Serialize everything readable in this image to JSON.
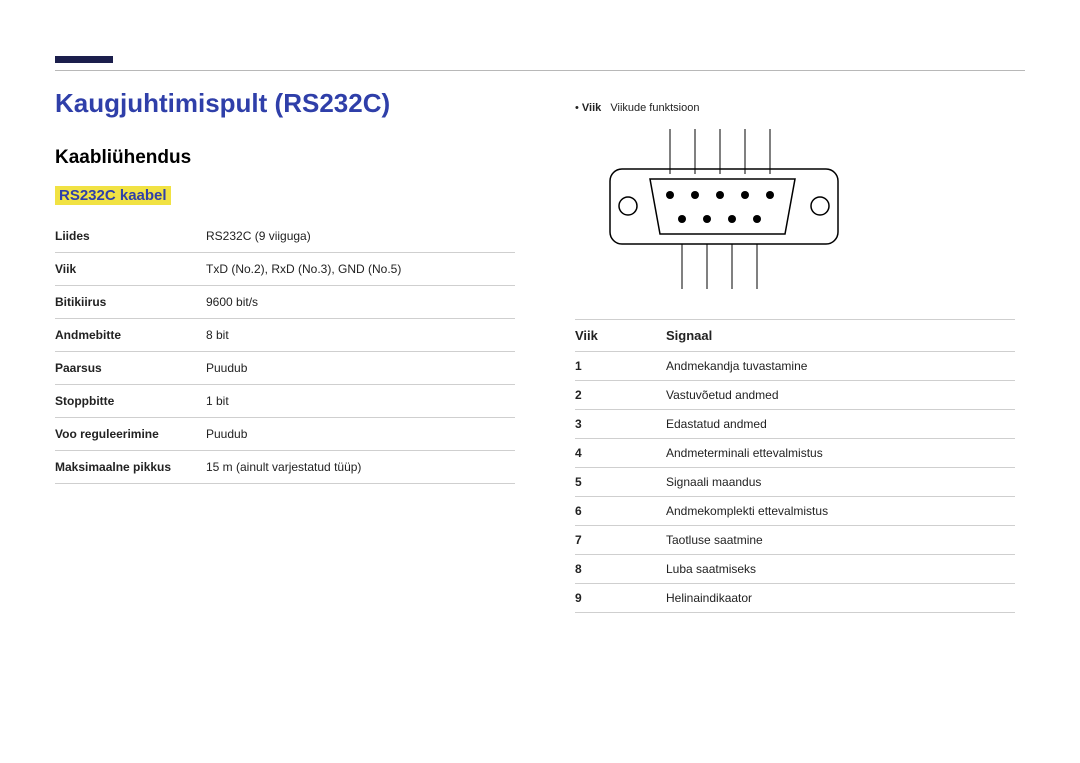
{
  "headings": {
    "title": "Kaugjuhtimispult (RS232C)",
    "section": "Kaabliühendus",
    "subsection": "RS232C kaabel"
  },
  "spec": {
    "rows": [
      {
        "label": "Liides",
        "value": "RS232C (9 viiguga)"
      },
      {
        "label": "Viik",
        "value": "TxD (No.2), RxD (No.3), GND (No.5)"
      },
      {
        "label": "Bitikiirus",
        "value": "9600 bit/s"
      },
      {
        "label": "Andmebitte",
        "value": "8 bit"
      },
      {
        "label": "Paarsus",
        "value": "Puudub"
      },
      {
        "label": "Stoppbitte",
        "value": "1 bit"
      },
      {
        "label": "Voo reguleerimine",
        "value": "Puudub"
      },
      {
        "label": "Maksimaalne pikkus",
        "value": "15 m (ainult varjestatud tüüp)"
      }
    ]
  },
  "right": {
    "legend_label": "Viik",
    "legend_text": "Viikude funktsioon",
    "table_header_pin": "Viik",
    "table_header_signal": "Signaal",
    "pins": [
      {
        "num": "1",
        "signal": "Andmekandja tuvastamine"
      },
      {
        "num": "2",
        "signal": "Vastuvõetud andmed"
      },
      {
        "num": "3",
        "signal": "Edastatud andmed"
      },
      {
        "num": "4",
        "signal": "Andmeterminali ettevalmistus"
      },
      {
        "num": "5",
        "signal": "Signaali maandus"
      },
      {
        "num": "6",
        "signal": "Andmekomplekti ettevalmistus"
      },
      {
        "num": "7",
        "signal": "Taotluse saatmine"
      },
      {
        "num": "8",
        "signal": "Luba saatmiseks"
      },
      {
        "num": "9",
        "signal": "Helinaindikaator"
      }
    ]
  }
}
